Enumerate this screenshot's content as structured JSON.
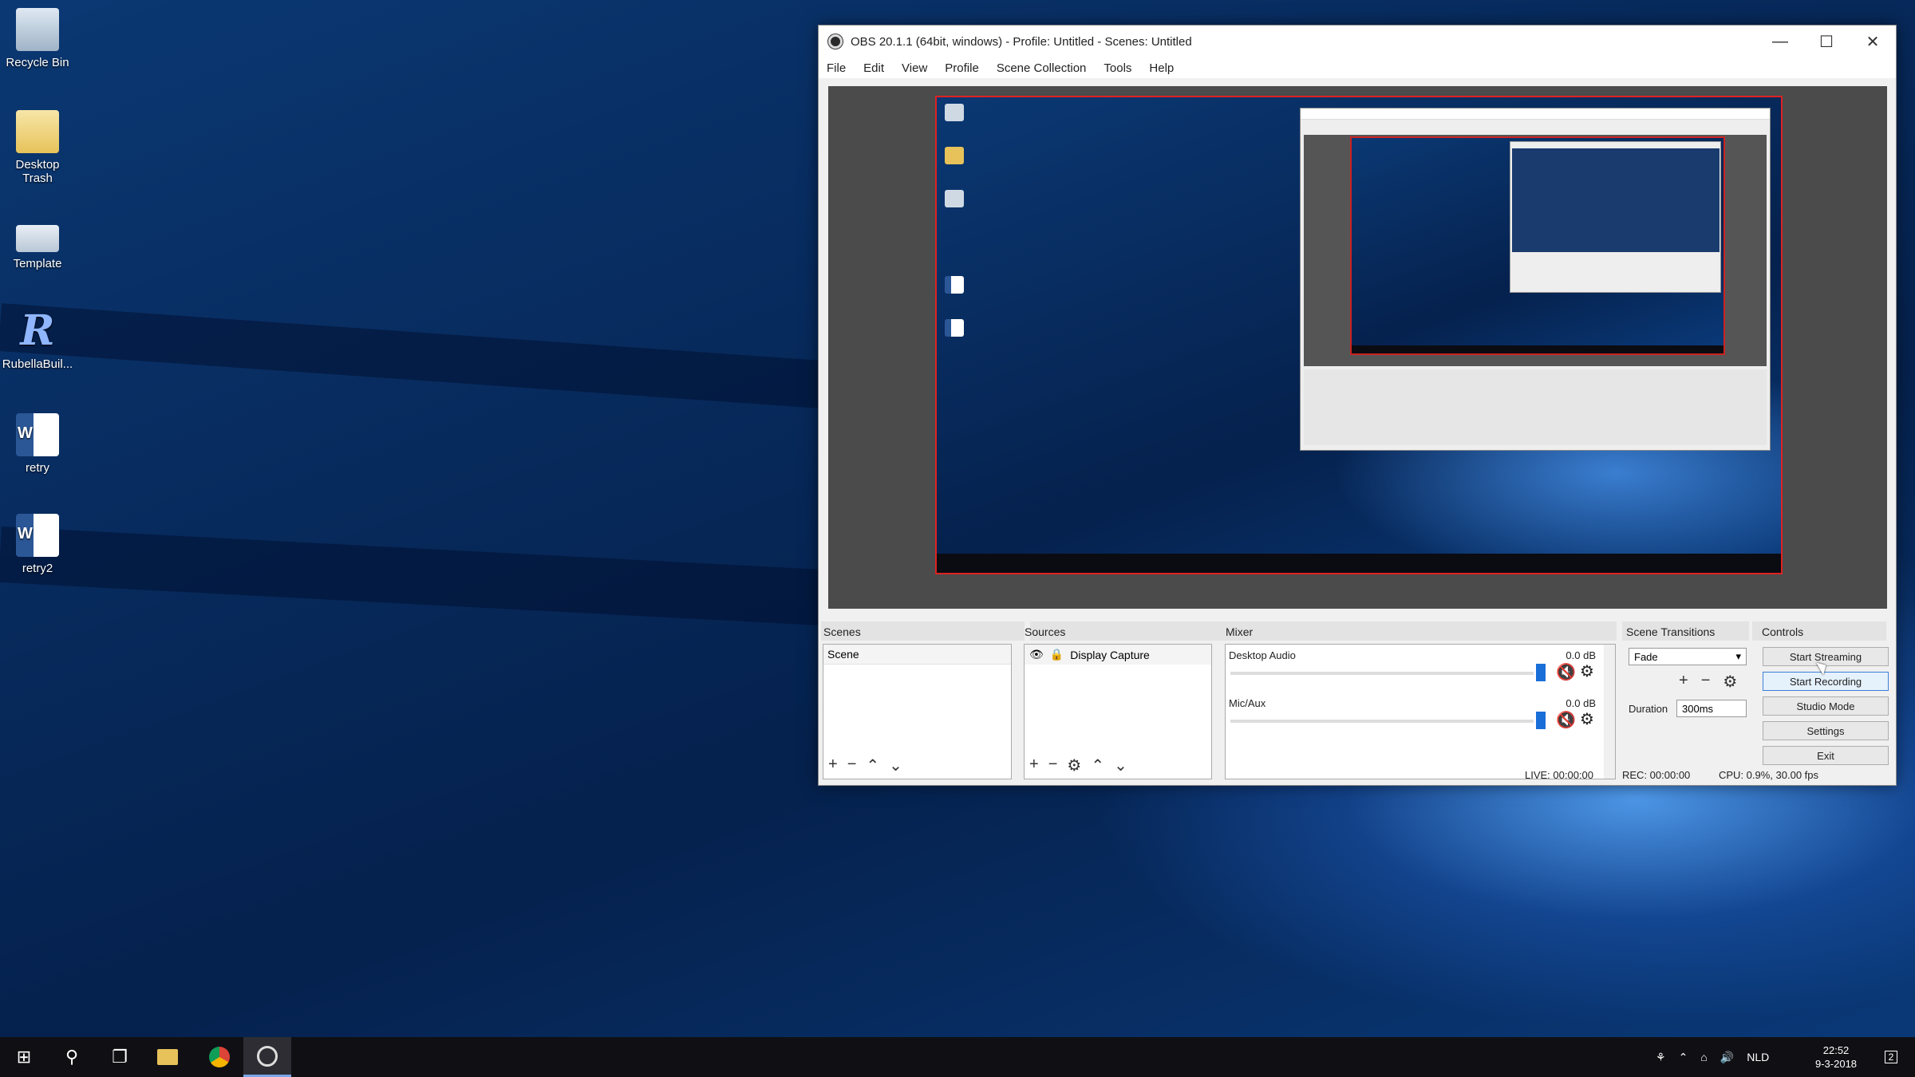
{
  "desktop": {
    "icons": [
      {
        "label": "Recycle Bin",
        "icon": "recycle-bin-icon"
      },
      {
        "label": "Desktop Trash",
        "icon": "folder-icon"
      },
      {
        "label": "Template",
        "icon": "template-icon"
      },
      {
        "label": "RubellaBuil...",
        "icon": "rubella-app-icon"
      },
      {
        "label": "retry",
        "icon": "word-document-icon"
      },
      {
        "label": "retry2",
        "icon": "word-document-icon"
      }
    ]
  },
  "obs": {
    "title": "OBS 20.1.1 (64bit, windows) - Profile: Untitled - Scenes: Untitled",
    "window_buttons": {
      "minimize": "—",
      "maximize": "☐",
      "close": "✕"
    },
    "menu": [
      "File",
      "Edit",
      "View",
      "Profile",
      "Scene Collection",
      "Tools",
      "Help"
    ],
    "docks": {
      "scenes": {
        "title": "Scenes",
        "items": [
          "Scene"
        ]
      },
      "sources": {
        "title": "Sources",
        "items": [
          "Display Capture"
        ]
      },
      "mixer": {
        "title": "Mixer",
        "channels": [
          {
            "name": "Desktop Audio",
            "db": "0.0 dB"
          },
          {
            "name": "Mic/Aux",
            "db": "0.0 dB"
          }
        ]
      },
      "transitions": {
        "title": "Scene Transitions",
        "selected": "Fade",
        "duration_label": "Duration",
        "duration_value": "300ms"
      },
      "controls": {
        "title": "Controls",
        "buttons": [
          "Start Streaming",
          "Start Recording",
          "Studio Mode",
          "Settings",
          "Exit"
        ]
      }
    },
    "status": {
      "live": "LIVE: 00:00:00",
      "rec": "REC: 00:00:00",
      "cpu": "CPU: 0.9%, 30.00 fps"
    }
  },
  "taskbar": {
    "language": "NLD",
    "time": "22:52",
    "date": "9-3-2018",
    "notification_count": "2"
  }
}
